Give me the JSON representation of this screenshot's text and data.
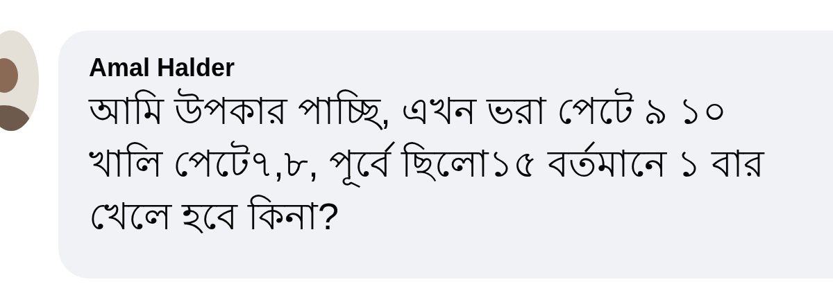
{
  "comment": {
    "author": "Amal Halder",
    "text": "আমি উপকার পাচ্ছি, এখন ভরা পেটে ৯ ১০ খালি পেটে৭,৮, পূর্বে ছিলো১৫ বর্তমানে ১ বার খেলে হবে কিনা?"
  }
}
